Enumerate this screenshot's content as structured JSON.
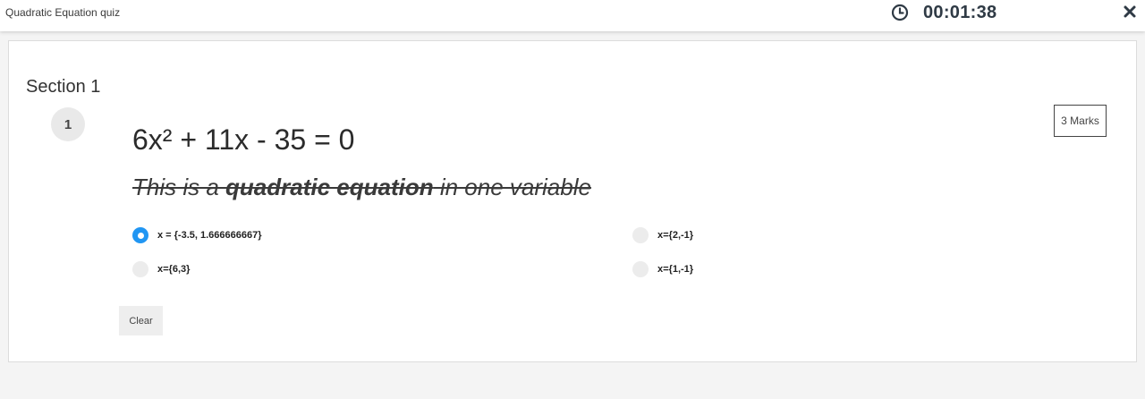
{
  "header": {
    "app_title": "Quadratic Equation quiz",
    "timer": "00:01:38",
    "clock_icon": "clock-icon",
    "close_icon": "close-icon"
  },
  "section": {
    "title": "Section 1"
  },
  "question": {
    "number": "1",
    "marks": "3 Marks",
    "equation": "6x² + 11x - 35 = 0",
    "statement_prefix": "This is a ",
    "statement_bold": "quadratic equation",
    "statement_suffix": " in one variable",
    "options": [
      {
        "label": "x = {-3.5, 1.666666667}",
        "selected": true
      },
      {
        "label": "x={2,-1}",
        "selected": false
      },
      {
        "label": "x={6,3}",
        "selected": false
      },
      {
        "label": "x={1,-1}",
        "selected": false
      }
    ],
    "clear_label": "Clear"
  },
  "colors": {
    "accent": "#2196f3",
    "timer_text": "#2f3a45",
    "radio_unselected": "#ececec"
  }
}
